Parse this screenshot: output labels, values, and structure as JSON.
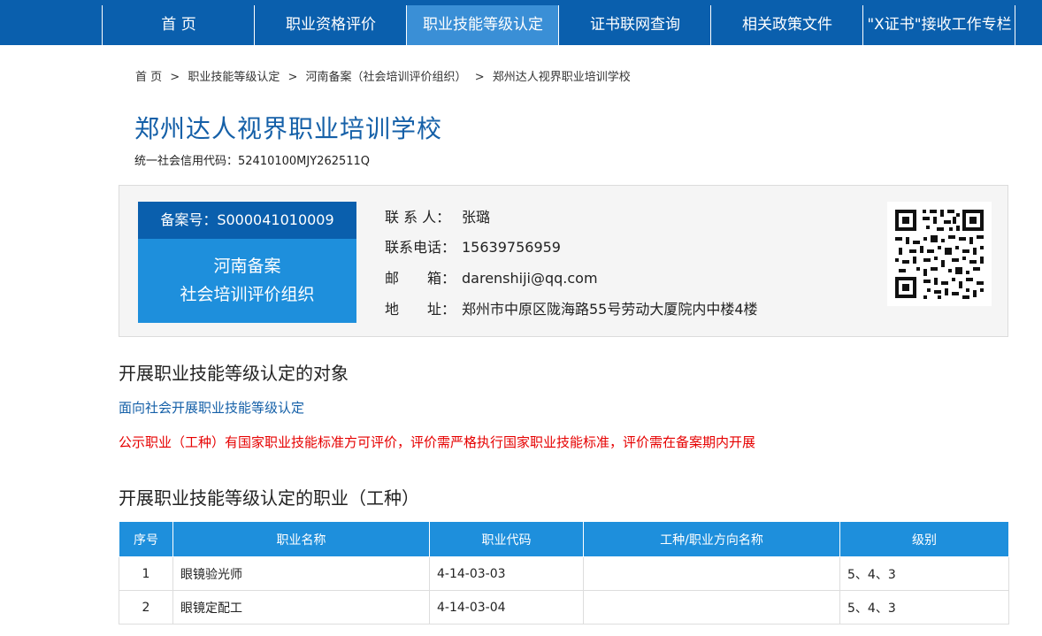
{
  "nav": {
    "items": [
      {
        "label": "首 页"
      },
      {
        "label": "职业资格评价"
      },
      {
        "label": "职业技能等级认定"
      },
      {
        "label": "证书联网查询"
      },
      {
        "label": "相关政策文件"
      },
      {
        "label": "\"X证书\"接收工作专栏"
      }
    ],
    "active_index": 2
  },
  "breadcrumb": [
    "首 页",
    "职业技能等级认定",
    "河南备案（社会培训评价组织）",
    "郑州达人视界职业培训学校"
  ],
  "breadcrumb_separator": ">",
  "org": {
    "name": "郑州达人视界职业培训学校",
    "credit_label": "统一社会信用代码：",
    "credit_code": "52410100MJY262511Q"
  },
  "card": {
    "record_label": "备案号：",
    "record_no": "S000041010009",
    "type_line1": "河南备案",
    "type_line2": "社会培训评价组织",
    "contact_label": "联 系 人：",
    "contact": "张璐",
    "phone_label": "联系电话：",
    "phone": "15639756959",
    "email_label": "邮　　箱：",
    "email": "darenshiji@qq.com",
    "address_label": "地　　址：",
    "address": "郑州市中原区陇海路55号劳动大厦院内中楼4楼"
  },
  "section1": {
    "title": "开展职业技能等级认定的对象",
    "scope": "面向社会开展职业技能等级认定",
    "notice": "公示职业（工种）有国家职业技能标准方可评价，评价需严格执行国家职业技能标准，评价需在备案期内开展"
  },
  "section2": {
    "title": "开展职业技能等级认定的职业（工种）"
  },
  "table": {
    "headers": [
      "序号",
      "职业名称",
      "职业代码",
      "工种/职业方向名称",
      "级别"
    ],
    "rows": [
      {
        "no": "1",
        "name": "眼镜验光师",
        "code": "4-14-03-03",
        "direction": "",
        "level": "5、4、3"
      },
      {
        "no": "2",
        "name": "眼镜定配工",
        "code": "4-14-03-04",
        "direction": "",
        "level": "5、4、3"
      }
    ]
  },
  "colors": {
    "nav_bg": "#0a5fad",
    "nav_active": "#3a8fd6",
    "table_header": "#1e8fdc",
    "title_blue": "#1560a8",
    "notice_red": "#e60000"
  }
}
